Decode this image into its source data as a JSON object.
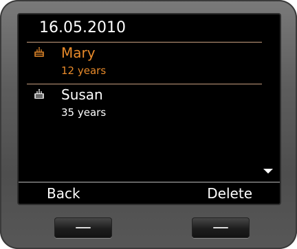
{
  "screen": {
    "date": "16.05.2010",
    "entries": [
      {
        "name": "Mary",
        "age": "12 years",
        "icon": "cake-icon",
        "selected": true
      },
      {
        "name": "Susan",
        "age": "35 years",
        "icon": "cake-icon",
        "selected": false
      }
    ]
  },
  "softkeys": {
    "left": "Back",
    "right": "Delete"
  },
  "colors": {
    "accent": "#e88a2a",
    "background": "#000000",
    "text": "#ffffff"
  }
}
